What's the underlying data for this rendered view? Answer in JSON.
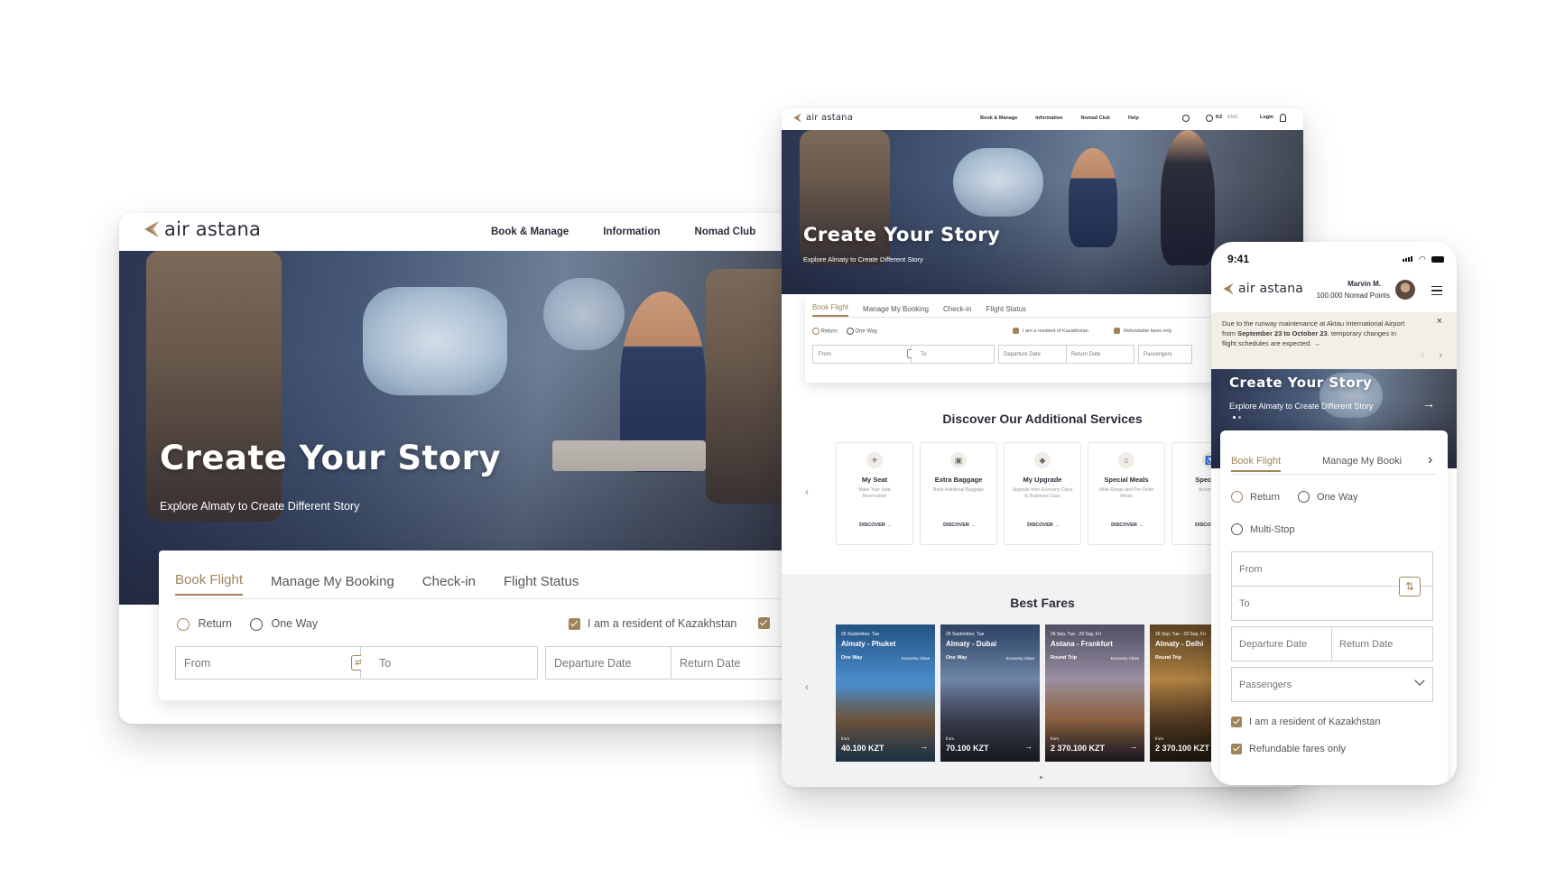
{
  "brand": {
    "name": "air astana",
    "accent": "#a0855b",
    "navy": "#2a2d3a"
  },
  "nav": {
    "book_manage": "Book & Manage",
    "information": "Information",
    "nomad_club": "Nomad Club",
    "help": "Help",
    "lang_country": "KZ",
    "lang": "ENG",
    "login": "Login"
  },
  "hero": {
    "title": "Create Your Story",
    "subtitle": "Explore Almaty to Create Different Story"
  },
  "booking": {
    "tabs": [
      "Book Flight",
      "Manage My Booking",
      "Check-in",
      "Flight Status"
    ],
    "trip_types": [
      "Return",
      "One Way",
      "Multi-Stop"
    ],
    "resident_label": "I am a resident of Kazakhstan",
    "refundable_label": "Refundable fares only",
    "from_placeholder": "From",
    "to_placeholder": "To",
    "departure_placeholder": "Departure Date",
    "return_placeholder": "Return Date",
    "passengers_placeholder": "Passengers"
  },
  "services": {
    "heading": "Discover Our Additional Services",
    "discover_label": "DISCOVER",
    "items": [
      {
        "title": "My Seat",
        "desc": "Make Your Seat Reservation",
        "icon": "seat-icon"
      },
      {
        "title": "Extra Baggage",
        "desc": "Book Additional Baggage",
        "icon": "baggage-icon"
      },
      {
        "title": "My Upgrade",
        "desc": "Upgrade from Economy Class to Business Class",
        "icon": "diamond-icon"
      },
      {
        "title": "Special Meals",
        "desc": "Wide Range and Pre-Order Meals",
        "icon": "meal-icon"
      },
      {
        "title": "Special A",
        "desc": "Accompany",
        "icon": "assist-icon"
      }
    ]
  },
  "fares": {
    "heading": "Best Fares",
    "items": [
      {
        "date": "26 September, Tue",
        "route": "Almaty - Phuket",
        "trip": "One Way",
        "class": "Economy Class",
        "from_label": "from",
        "price": "40.100 KZT"
      },
      {
        "date": "26 September, Tue",
        "route": "Almaty - Dubai",
        "trip": "One Way",
        "class": "Economy Class",
        "from_label": "from",
        "price": "70.100 KZT"
      },
      {
        "date": "26 Sep, Tue - 29 Sep, Fri",
        "route": "Astana - Frankfurt",
        "trip": "Round Trip",
        "class": "Economy Class",
        "from_label": "from",
        "price": "2 370.100 KZT"
      },
      {
        "date": "26 Sep, Tue - 29 Sep, Fri",
        "route": "Almaty - Delhi",
        "trip": "Round Trip",
        "class": "",
        "from_label": "from",
        "price": "2 370.100 KZT"
      }
    ]
  },
  "mobile": {
    "time": "9:41",
    "user_name": "Marvin M.",
    "points": "100.000 Nomad Points",
    "notice_pre": "Due to the runway maintenance at Aktau International Airport from ",
    "notice_dates": "September 23 to October 23",
    "notice_post": ", temporary changes in flight schedules are expected.",
    "tab_book": "Book Flight",
    "tab_manage": "Manage My Booki"
  }
}
